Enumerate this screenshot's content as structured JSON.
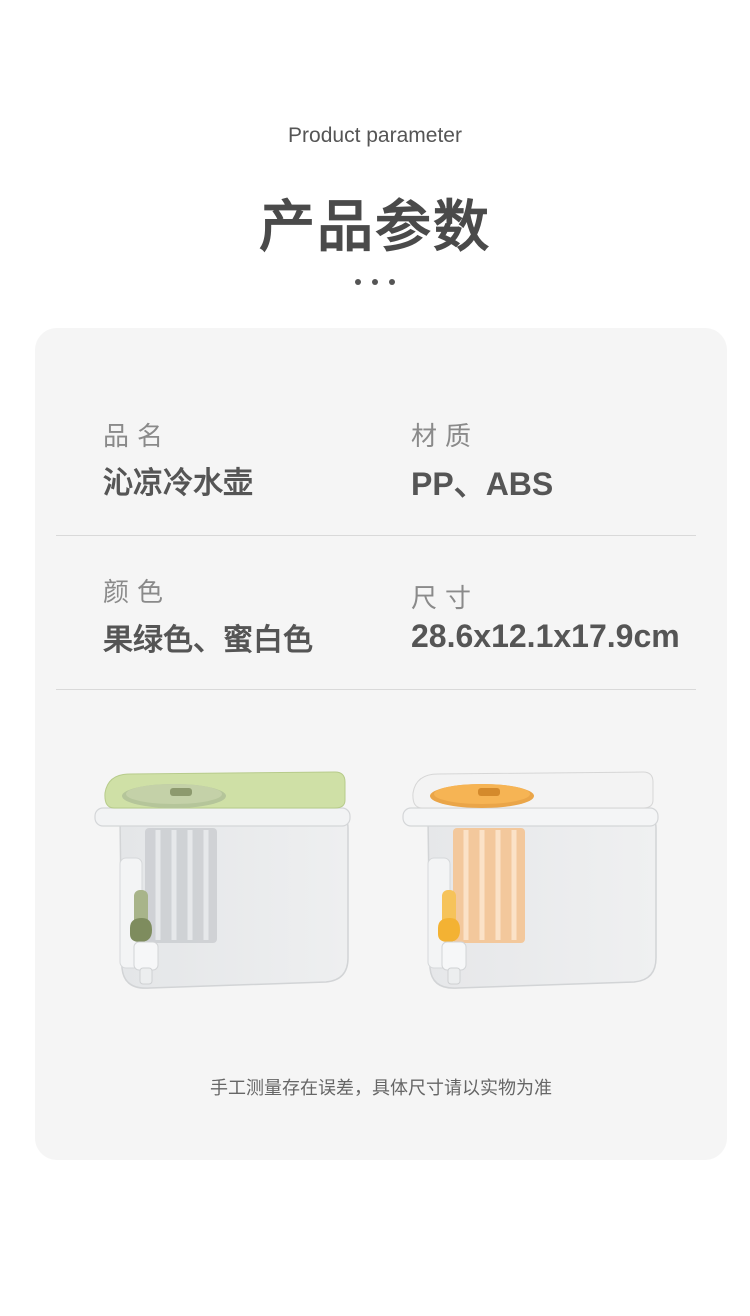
{
  "header": {
    "subtitle": "Product parameter",
    "title": "产品参数"
  },
  "params": [
    {
      "label": "品名",
      "value": "沁凉冷水壶"
    },
    {
      "label": "材质",
      "value": "PP、ABS"
    },
    {
      "label": "颜色",
      "value": "果绿色、蜜白色"
    },
    {
      "label": "尺寸",
      "value": "28.6x12.1x17.9cm"
    }
  ],
  "products": [
    {
      "variant": "green",
      "lid_color": "#cfe0a6",
      "accent_color": "#9db87a",
      "spout_color": "#7e8c5e"
    },
    {
      "variant": "white",
      "lid_color": "#f3f3f3",
      "accent_color": "#f6b454",
      "spout_color": "#f3b233"
    }
  ],
  "note": "手工测量存在误差，具体尺寸请以实物为准"
}
